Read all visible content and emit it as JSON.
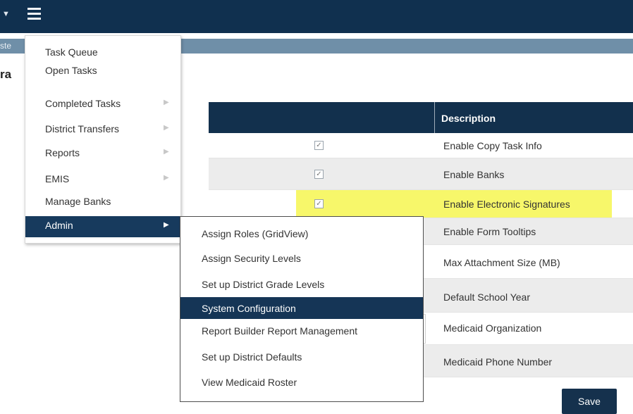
{
  "subbar_text": "ste",
  "page_title": "ra",
  "table": {
    "header": "Description",
    "rows": [
      {
        "desc": "Enable Copy Task Info",
        "checked": true
      },
      {
        "desc": "Enable Banks",
        "checked": true
      },
      {
        "desc": "Enable Electronic Signatures",
        "checked": true,
        "highlighted": true
      },
      {
        "desc": "Enable Form Tooltips"
      },
      {
        "desc": "Max Attachment Size (MB)"
      },
      {
        "desc": "Default School Year"
      },
      {
        "desc": "Medicaid Organization"
      },
      {
        "desc": "Medicaid Phone Number"
      }
    ]
  },
  "save_label": "Save",
  "menu": {
    "items": [
      {
        "label": "Task Queue"
      },
      {
        "label": "Open Tasks"
      },
      {
        "label": "Completed Tasks",
        "has_submenu": true
      },
      {
        "label": "District Transfers",
        "has_submenu": true
      },
      {
        "label": "Reports",
        "has_submenu": true
      },
      {
        "label": "EMIS",
        "has_submenu": true
      },
      {
        "label": "Manage Banks"
      },
      {
        "label": "Admin",
        "has_submenu": true,
        "active": true
      }
    ]
  },
  "submenu": {
    "items": [
      {
        "label": "Assign Roles (GridView)"
      },
      {
        "label": "Assign Security Levels"
      },
      {
        "label": "Set up District Grade Levels"
      },
      {
        "label": "System Configuration",
        "active": true
      },
      {
        "label": "Report Builder Report Management"
      },
      {
        "label": "Set up District Defaults"
      },
      {
        "label": "View Medicaid Roster"
      }
    ]
  },
  "icons": {
    "checkmark": "✓",
    "submenu_arrow": "▶",
    "caret": "▼"
  },
  "colors": {
    "navbar": "#10304f",
    "subbar": "#6f8fa8",
    "highlight": "#f7f76a",
    "menu_active": "#173a5d"
  }
}
